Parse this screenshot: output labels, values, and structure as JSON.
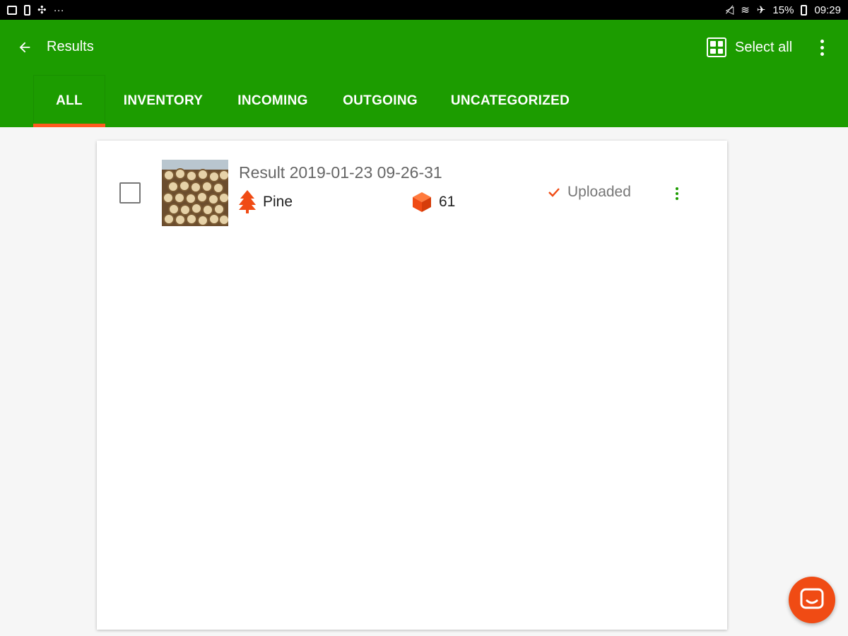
{
  "status_bar": {
    "time": "09:29",
    "battery": "15%",
    "icons": [
      "gallery-icon",
      "battery-saver-icon",
      "fan-icon",
      "more-notifications-icon",
      "mute-icon",
      "wifi-icon",
      "airplane-icon",
      "battery-icon"
    ]
  },
  "toolbar": {
    "title": "Results",
    "select_all_label": "Select all",
    "back_icon": "arrow-left-icon",
    "more_icon": "more-vert-icon"
  },
  "tabs": [
    {
      "label": "ALL",
      "active": true
    },
    {
      "label": "INVENTORY",
      "active": false
    },
    {
      "label": "INCOMING",
      "active": false
    },
    {
      "label": "OUTGOING",
      "active": false
    },
    {
      "label": "UNCATEGORIZED",
      "active": false
    }
  ],
  "results": [
    {
      "title": "Result 2019-01-23 09-26-31",
      "species": "Pine",
      "count": "61",
      "status": "Uploaded",
      "checked": false
    }
  ],
  "colors": {
    "primary": "#1c9c00",
    "accent": "#ff5a1f",
    "fab": "#f04b14"
  },
  "fab": {
    "icon": "chat-icon"
  }
}
